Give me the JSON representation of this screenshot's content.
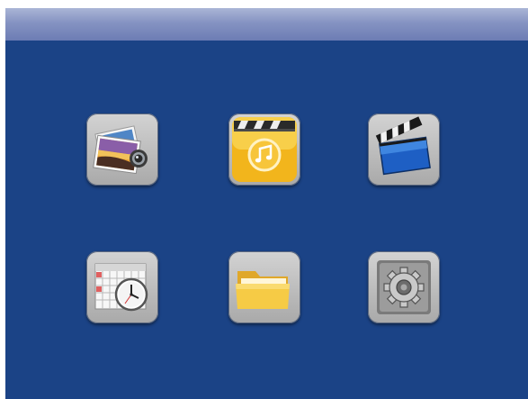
{
  "colors": {
    "screen_background": "#1b4386",
    "title_bar_top": "#aab5d6",
    "title_bar_bottom": "#6c7cb4",
    "tile_light": "#d3d3d3",
    "tile_dark": "#a9a9a9",
    "music_gold": "#f2b51c",
    "folder_yellow": "#f4c53a"
  },
  "title_bar": {
    "title": ""
  },
  "menu": {
    "items": [
      {
        "icon": "photo-viewer-icon"
      },
      {
        "icon": "music-player-icon"
      },
      {
        "icon": "video-clapperboard-icon"
      },
      {
        "icon": "calendar-clock-icon"
      },
      {
        "icon": "folder-icon"
      },
      {
        "icon": "settings-gear-icon"
      }
    ]
  }
}
